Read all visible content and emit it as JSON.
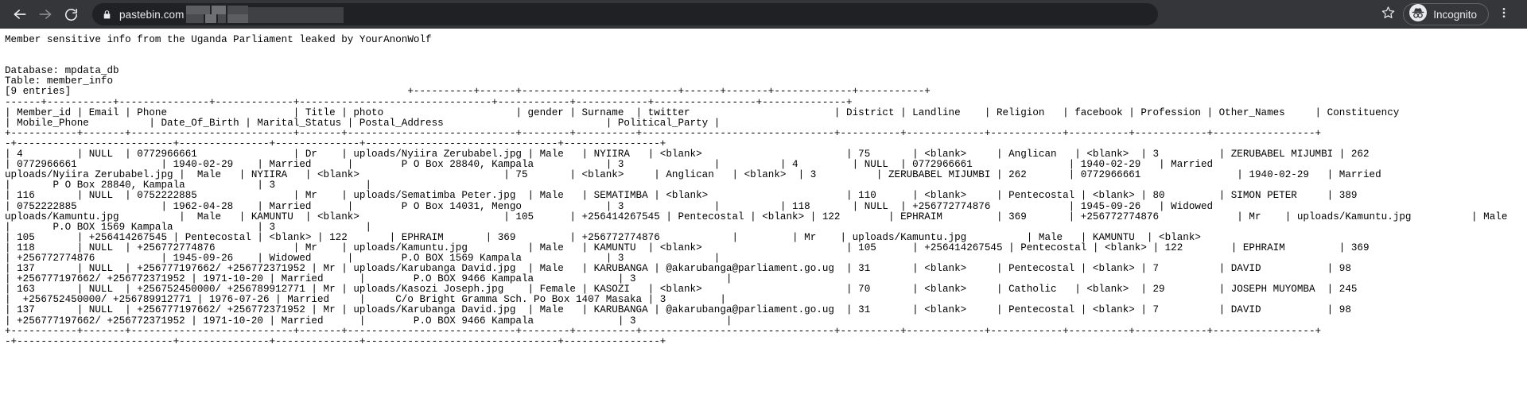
{
  "browser": {
    "back_icon": "arrow-left-icon",
    "forward_icon": "arrow-right-icon",
    "reload_icon": "reload-icon",
    "lock_icon": "lock-icon",
    "url": "pastebin.com",
    "bookmark_icon": "star-icon",
    "incognito_icon": "incognito-hat-icon",
    "incognito_label": "Incognito",
    "menu_icon": "three-dot-menu-icon",
    "colors": {
      "chrome_bg": "#35363a",
      "omnibox_bg": "#202124",
      "text": "#e8eaed",
      "page_bg": "#ffffff",
      "page_text": "#000000"
    }
  },
  "page": {
    "title_line": "Member sensitive info from the Uganda Parliament leaked by YourAnonWolf",
    "database_label": "Database: mpdata_db",
    "table_label": "Table: member_info",
    "entries_label": "[9 entries]",
    "content": "Member sensitive info from the Uganda Parliament leaked by YourAnonWolf\n\n\nDatabase: mpdata_db\nTable: member_info\n[9 entries]                                                        +----------+------+--------------------------+------+-------+-------------+-----------+\n------+-----------+---------------+-------------+--------------------------------+------------+------------+-----------------+--------------+\n| Member_id | Email | Phone                     | Title | photo                      | gender | Surname  | twitter                        | District | Landline    | Religion   | facebook | Profession | Other_Names     | Constituency\n| Mobile_Phone          | Date_Of_Birth | Marital_Status | Postal_Address                           | Political_Party |\n+-----------+-------+---------------------------+-------+----------------------------+--------+----------+--------------------------------+----------+-------------+------------+----------+------------+-----------------+\n-+--------------------------+---------------+--------------+--------------------------------+----------------+\n| 4         | NULL  | 0772966661                | Dr    | uploads/Nyiira Zerubabel.jpg | Male   | NYIIRA   | <blank>                        | 75       | <blank>     | Anglican   | <blank>  | 3          | ZERUBABEL MIJUMBI | 262\n| 0772966661              | 1940-02-29    | Married      |        P O Box 28840, Kampala            | 3               |          | 4         | NULL  | 0772966661                | 1940-02-29   | Married\nuploads/Nyiira Zerubabel.jpg |  Male   | NYIIRA   | <blank>                        | 75       | <blank>     | Anglican   | <blank>  | 3          | ZERUBABEL MIJUMBI | 262       | 0772966661                | 1940-02-29   | Married\n|       P O Box 28840, Kampala            | 3               |\n| 116       | NULL  | 0752222885                | Mr    | uploads/Sematimba Peter.jpg  | Male   | SEMATIMBA | <blank>                       | 110      | <blank>     | Pentecostal | <blank> | 80         | SIMON PETER     | 389\n| 0752222885              | 1962-04-28    | Married      |        P O Box 14031, Mengo              | 3               |          | 118       | NULL  | +256772774876             | 1945-09-26   | Widowed\nuploads/Kamuntu.jpg          |  Male   | KAMUNTU  | <blank>                        | 105      | +256414267545 | Pentecostal | <blank> | 122        | EPHRAIM         | 369       | +256772774876             | Mr    | uploads/Kamuntu.jpg          | Male   | KAMUNTU  | <blank>\n|       P.O BOX 1569 Kampala              | 3               |\n| 105       | +256414267545 | Pentecostal | <blank> | 122       | EPHRAIM       | 369         | +256772774876            |         | Mr    | uploads/Kamuntu.jpg          | Male   | KAMUNTU  | <blank>\n| 118       | NULL  | +256772774876             | Mr    | uploads/Kamuntu.jpg          | Male   | KAMUNTU  | <blank>                        | 105      | +256414267545 | Pentecostal | <blank> | 122        | EPHRAIM         | 369\n| +256772774876           | 1945-09-26    | Widowed      |        P.O BOX 1569 Kampala              | 3               |\n| 137       | NULL  | +256777197662/ +256772371952 | Mr | uploads/Karubanga David.jpg  | Male   | KARUBANGA | @akarubanga@parliament.go.ug  | 31       | <blank>     | Pentecostal | <blank> | 7          | DAVID           | 98\n| +256777197662/ +256772371952 | 1971-10-20 | Married      |        P.O BOX 9466 Kampala              | 3               |\n| 163       | NULL  | +256752450000/ +256789912771 | Mr | uploads/Kasozi Joseph.jpg    | Female | KASOZI   | <blank>                        | 70       | <blank>     | Catholic   | <blank>  | 29         | JOSEPH MUYOMBA  | 245\n|  +256752450000/ +256789912771 | 1976-07-26 | Married     |     C/o Bright Gramma Sch. Po Box 1407 Masaka | 3         |\n| 137       | NULL  | +256777197662/ +256772371952 | Mr | uploads/Karubanga David.jpg  | Male   | KARUBANGA | @akarubanga@parliament.go.ug  | 31       | <blank>     | Pentecostal | <blank> | 7          | DAVID           | 98\n| +256777197662/ +256772371952 | 1971-10-20 | Married      |        P.O BOX 9466 Kampala              | 3               |\n+-----------+-------+---------------------------+-------+----------------------------+--------+----------+--------------------------------+----------+-------------+------------+----------+------------+-----------------+\n-+--------------------------+---------------+--------------+--------------------------------+----------------+"
  },
  "table_data": {
    "database": "mpdata_db",
    "table": "member_info",
    "entries": "9",
    "columns": [
      "Member_id",
      "Email",
      "Phone",
      "Title",
      "photo",
      "gender",
      "Surname",
      "twitter",
      "District",
      "Landline",
      "Religion",
      "facebook",
      "Profession",
      "Other_Names",
      "Constituency",
      "Mobile_Phone",
      "Date_Of_Birth",
      "Marital_Status",
      "Postal_Address",
      "Political_Party"
    ],
    "rows": [
      {
        "Member_id": "4",
        "Email": "NULL",
        "Phone": "0772966661",
        "Title": "Dr",
        "photo": "uploads/Nyiira Zerubabel.jpg",
        "gender": "Male",
        "Surname": "NYIIRA",
        "twitter": "<blank>",
        "District": "75",
        "Landline": "<blank>",
        "Religion": "Anglican",
        "facebook": "<blank>",
        "Profession": "3",
        "Other_Names": "ZERUBABEL MIJUMBI",
        "Constituency": "262",
        "Mobile_Phone": "0772966661",
        "Date_Of_Birth": "1940-02-29",
        "Marital_Status": "Married",
        "Postal_Address": "P O Box 28840, Kampala",
        "Political_Party": "3"
      },
      {
        "Member_id": "116",
        "Email": "NULL",
        "Phone": "0752222885",
        "Title": "Mr",
        "photo": "uploads/Sematimba Peter.jpg",
        "gender": "Male",
        "Surname": "SEMATIMBA",
        "twitter": "<blank>",
        "District": "110",
        "Landline": "<blank>",
        "Religion": "Pentecostal",
        "facebook": "<blank>",
        "Profession": "80",
        "Other_Names": "SIMON PETER",
        "Constituency": "389",
        "Mobile_Phone": "0752222885",
        "Date_Of_Birth": "1962-04-28",
        "Marital_Status": "Married",
        "Postal_Address": "P O Box 14031, Mengo",
        "Political_Party": "3"
      },
      {
        "Member_id": "118",
        "Email": "NULL",
        "Phone": "+256772774876",
        "Title": "Mr",
        "photo": "uploads/Kamuntu.jpg",
        "gender": "Male",
        "Surname": "KAMUNTU",
        "twitter": "<blank>",
        "District": "105",
        "Landline": "+256414267545",
        "Religion": "Pentecostal",
        "facebook": "<blank>",
        "Profession": "122",
        "Other_Names": "EPHRAIM",
        "Constituency": "369",
        "Mobile_Phone": "+256772774876",
        "Date_Of_Birth": "1945-09-26",
        "Marital_Status": "Widowed",
        "Postal_Address": "P.O BOX 1569 Kampala",
        "Political_Party": "3"
      },
      {
        "Member_id": "137",
        "Email": "NULL",
        "Phone": "+256777197662/ +256772371952",
        "Title": "Mr",
        "photo": "uploads/Karubanga David.jpg",
        "gender": "Male",
        "Surname": "KARUBANGA",
        "twitter": "@akarubanga@parliament.go.ug",
        "District": "31",
        "Landline": "<blank>",
        "Religion": "Pentecostal",
        "facebook": "<blank>",
        "Profession": "7",
        "Other_Names": "DAVID",
        "Constituency": "98",
        "Mobile_Phone": "+256777197662/ +256772371952",
        "Date_Of_Birth": "1971-10-20",
        "Marital_Status": "Married",
        "Postal_Address": "P.O BOX 9466 Kampala",
        "Political_Party": "3"
      },
      {
        "Member_id": "163",
        "Email": "NULL",
        "Phone": "+256752450000/ +256789912771",
        "Title": "Mr",
        "photo": "uploads/Kasozi Joseph.jpg",
        "gender": "Female",
        "Surname": "KASOZI",
        "twitter": "<blank>",
        "District": "70",
        "Landline": "<blank>",
        "Religion": "Catholic",
        "facebook": "<blank>",
        "Profession": "29",
        "Other_Names": "JOSEPH MUYOMBA",
        "Constituency": "245",
        "Mobile_Phone": "+256752450000/ +256789912771",
        "Date_Of_Birth": "1976-07-26",
        "Marital_Status": "Married",
        "Postal_Address": "C/o Bright Gramma Sch. Po Box 1407 Masaka",
        "Political_Party": "3"
      },
      {
        "Member_id": "137",
        "Email": "NULL",
        "Phone": "+256777197662/ +256772371952",
        "Title": "Mr",
        "photo": "uploads/Karubanga David.jpg",
        "gender": "Male",
        "Surname": "KARUBANGA",
        "twitter": "@akarubanga@parliament.go.ug",
        "District": "31",
        "Landline": "<blank>",
        "Religion": "Pentecostal",
        "facebook": "<blank>",
        "Profession": "7",
        "Other_Names": "DAVID",
        "Constituency": "98",
        "Mobile_Phone": "+256777197662/ +256772371952",
        "Date_Of_Birth": "1971-10-20",
        "Marital_Status": "Married",
        "Postal_Address": "P.O BOX 9466 Kampala",
        "Political_Party": "3"
      }
    ]
  }
}
